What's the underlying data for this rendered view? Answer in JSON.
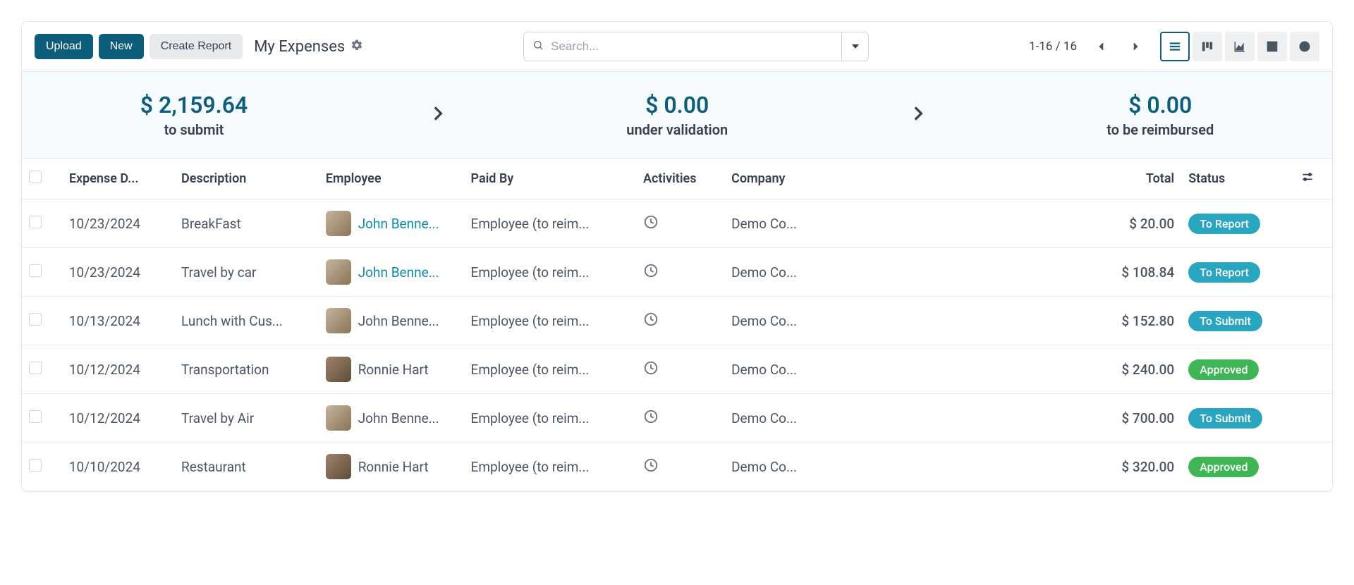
{
  "toolbar": {
    "upload": "Upload",
    "new": "New",
    "create_report": "Create Report",
    "title": "My Expenses",
    "search_placeholder": "Search...",
    "pager": "1-16 / 16"
  },
  "summary": [
    {
      "amount": "$ 2,159.64",
      "label": "to submit"
    },
    {
      "amount": "$ 0.00",
      "label": "under validation"
    },
    {
      "amount": "$ 0.00",
      "label": "to be reimbursed"
    }
  ],
  "columns": {
    "date": "Expense D...",
    "description": "Description",
    "employee": "Employee",
    "paidby": "Paid By",
    "activities": "Activities",
    "company": "Company",
    "total": "Total",
    "status": "Status"
  },
  "rows": [
    {
      "date": "10/23/2024",
      "description": "BreakFast",
      "employee": "John Benne...",
      "avatar": "john",
      "paidby": "Employee (to reim...",
      "company": "Demo Co...",
      "total": "$ 20.00",
      "status": "To Report",
      "status_color": "teal",
      "highlight": true
    },
    {
      "date": "10/23/2024",
      "description": "Travel by car",
      "employee": "John Benne...",
      "avatar": "john",
      "paidby": "Employee (to reim...",
      "company": "Demo Co...",
      "total": "$ 108.84",
      "status": "To Report",
      "status_color": "teal",
      "highlight": true
    },
    {
      "date": "10/13/2024",
      "description": "Lunch with Cus...",
      "employee": "John Benne...",
      "avatar": "john",
      "paidby": "Employee (to reim...",
      "company": "Demo Co...",
      "total": "$ 152.80",
      "status": "To Submit",
      "status_color": "teal",
      "highlight": false
    },
    {
      "date": "10/12/2024",
      "description": "Transportation",
      "employee": "Ronnie Hart",
      "avatar": "ronnie",
      "paidby": "Employee (to reim...",
      "company": "Demo Co...",
      "total": "$ 240.00",
      "status": "Approved",
      "status_color": "green",
      "highlight": false
    },
    {
      "date": "10/12/2024",
      "description": "Travel by Air",
      "employee": "John Benne...",
      "avatar": "john",
      "paidby": "Employee (to reim...",
      "company": "Demo Co...",
      "total": "$ 700.00",
      "status": "To Submit",
      "status_color": "teal",
      "highlight": false
    },
    {
      "date": "10/10/2024",
      "description": "Restaurant",
      "employee": "Ronnie Hart",
      "avatar": "ronnie",
      "paidby": "Employee (to reim...",
      "company": "Demo Co...",
      "total": "$ 320.00",
      "status": "Approved",
      "status_color": "green",
      "highlight": false
    }
  ]
}
